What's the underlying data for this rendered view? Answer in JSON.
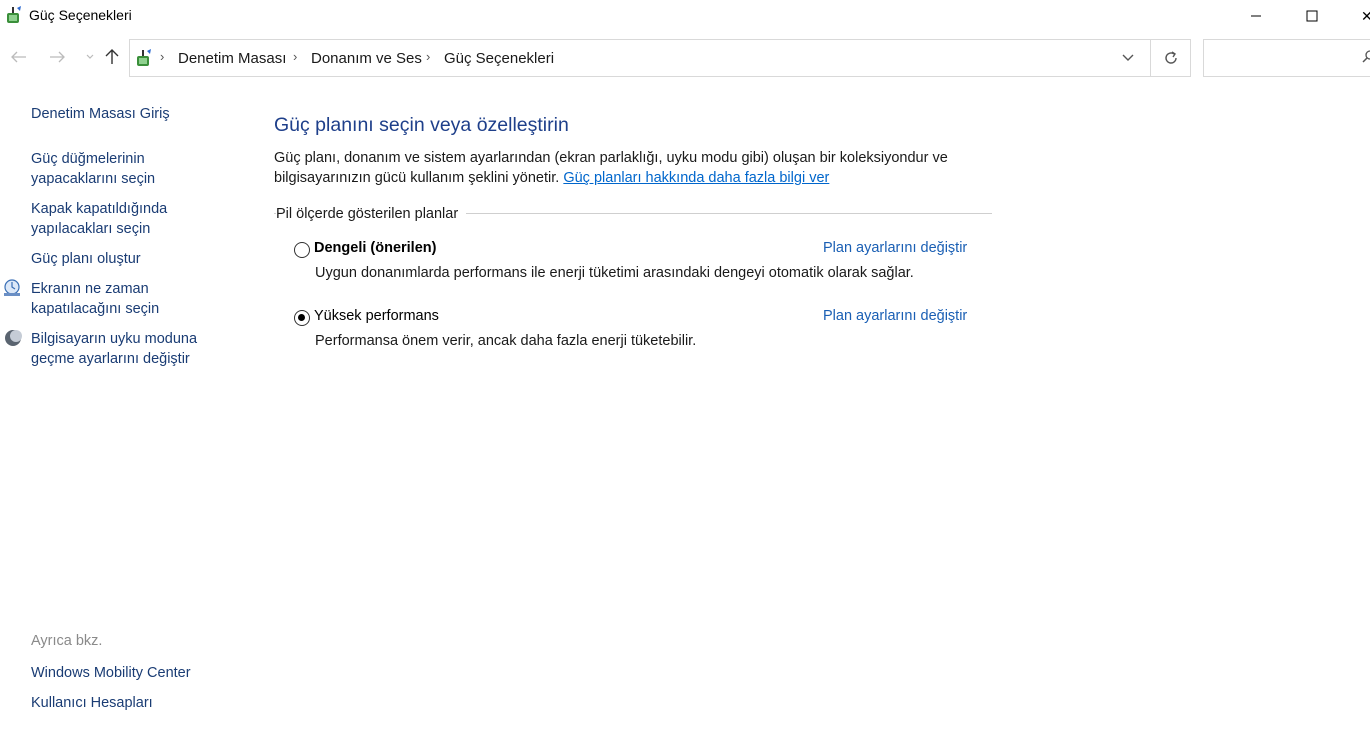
{
  "window": {
    "title": "Güç Seçenekleri",
    "close_glyph": "✕"
  },
  "nav": {
    "breadcrumb": [
      "Denetim Masası",
      "Donanım ve Ses",
      "Güç Seçenekleri"
    ],
    "search_placeholder": ""
  },
  "sidebar": {
    "home": "Denetim Masası Giriş",
    "links": [
      "Güç düğmelerinin yapacaklarını seçin",
      "Kapak kapatıldığında yapılacakları seçin",
      "Güç planı oluştur",
      "Ekranın ne zaman kapatılacağını seçin",
      "Bilgisayarın uyku moduna geçme ayarlarını değiştir"
    ],
    "see_also_heading": "Ayrıca bkz.",
    "see_also": [
      "Windows Mobility Center",
      "Kullanıcı Hesapları"
    ]
  },
  "main": {
    "title": "Güç planını seçin veya özelleştirin",
    "description": "Güç planı, donanım ve sistem ayarlarından (ekran parlaklığı, uyku modu gibi) oluşan bir koleksiyondur ve bilgisayarınızın gücü kullanım şeklini yönetir.",
    "more_info_link": "Güç planları hakkında daha fazla bilgi ver",
    "group_label": "Pil ölçerde gösterilen planlar",
    "plans": [
      {
        "name": "Dengeli (önerilen)",
        "selected": false,
        "link": "Plan ayarlarını değiştir",
        "description": "Uygun donanımlarda performans ile enerji tüketimi arasındaki dengeyi otomatik olarak sağlar."
      },
      {
        "name": "Yüksek performans",
        "selected": true,
        "link": "Plan ayarlarını değiştir",
        "description": "Performansa önem verir, ancak daha fazla enerji tüketebilir."
      }
    ]
  },
  "colors": {
    "link": "#1a3c74",
    "title": "#1e3f8a",
    "hyperlink": "#0066cc"
  }
}
